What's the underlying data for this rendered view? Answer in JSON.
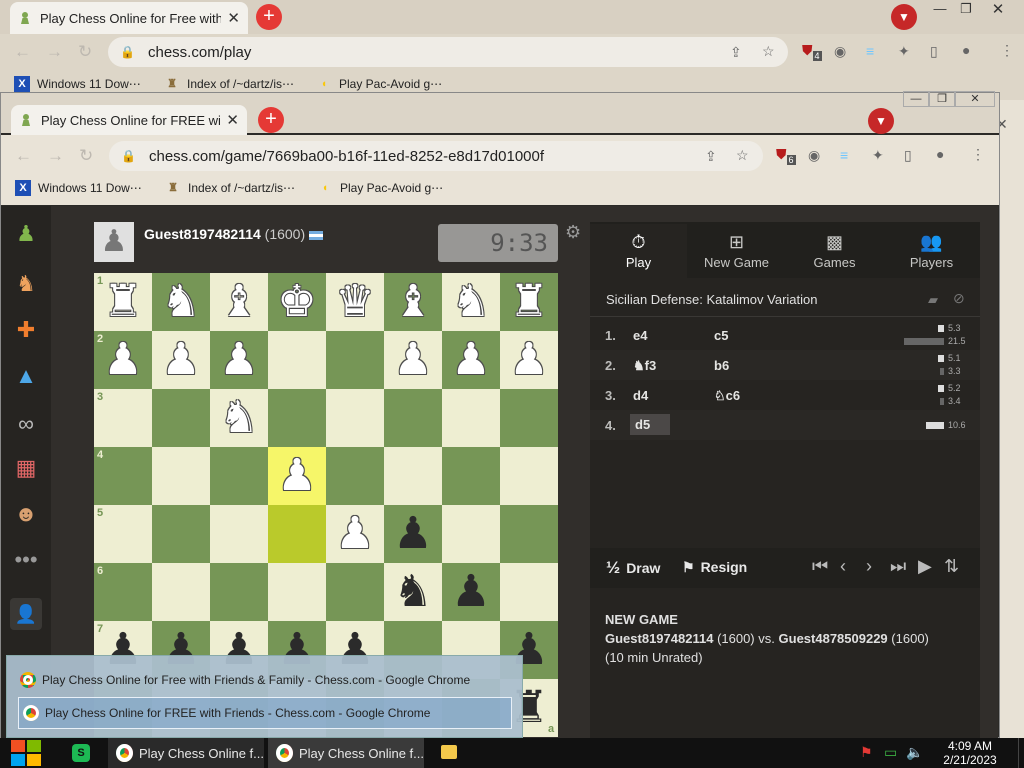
{
  "outer_window": {
    "tab_title": "Play Chess Online for Free with Friends & Family - Chess.com",
    "url": "chess.com/play",
    "ext_badge": "4",
    "bookmarks": [
      "Windows 11 Dow⋯",
      "Index of /~dartz/is⋯",
      "Play Pac-Avoid g⋯"
    ]
  },
  "inner_window": {
    "tab_title": "Play Chess Online for FREE with Friends - Chess.com",
    "url": "chess.com/game/7669ba00-b16f-11ed-8252-e8d17d01000f",
    "ext_badge": "6",
    "bookmarks": [
      "Windows 11 Dow⋯",
      "Index of /~dartz/is⋯",
      "Play Pac-Avoid g⋯"
    ]
  },
  "game": {
    "opponent": "Guest8197482114",
    "opponent_rating": "(1600)",
    "clock": "9:33",
    "board": {
      "rows": [
        [
          "R",
          "N",
          "B",
          "K",
          "Q",
          "B",
          "N",
          "R"
        ],
        [
          "P",
          "P",
          "P",
          "",
          "",
          "P",
          "P",
          "P"
        ],
        [
          "",
          "",
          "N",
          "",
          "",
          "",
          "",
          ""
        ],
        [
          "",
          "",
          "",
          "P",
          "",
          "",
          "",
          ""
        ],
        [
          "",
          "",
          "",
          "",
          "P",
          "p",
          "",
          ""
        ],
        [
          "",
          "",
          "",
          "",
          "",
          "n",
          "p",
          ""
        ],
        [
          "p",
          "p",
          "p",
          "p",
          "p",
          "",
          "",
          "p"
        ],
        [
          "",
          "",
          "",
          "",
          "",
          "",
          "",
          "r"
        ]
      ],
      "rank_labels": [
        "1",
        "2",
        "3",
        "4",
        "5",
        "6",
        "7"
      ],
      "file_label_h": "a",
      "highlighted_squares": [
        "e4",
        "e5"
      ],
      "colors": {
        "light": "#eeeed2",
        "dark": "#769656",
        "highlight_light": "#f6f669",
        "highlight_dark": "#baca2b"
      }
    }
  },
  "panel": {
    "tabs": [
      "Play",
      "New Game",
      "Games",
      "Players"
    ],
    "opening": "Sicilian Defense: Katalimov Variation",
    "moves": [
      {
        "no": "1.",
        "white": "e4",
        "black": "c5",
        "wt": "5.3",
        "bt": "21.5",
        "wt_frac": 0.15,
        "bt_frac": 1.0
      },
      {
        "no": "2.",
        "white": "f3",
        "white_piece": "♞",
        "black": "b6",
        "wt": "5.1",
        "bt": "3.3",
        "wt_frac": 0.14,
        "bt_frac": 0.1
      },
      {
        "no": "3.",
        "white": "d4",
        "black": "c6",
        "black_piece": "♘",
        "wt": "5.2",
        "bt": "3.4",
        "wt_frac": 0.14,
        "bt_frac": 0.1
      },
      {
        "no": "4.",
        "white": "d5",
        "black": "",
        "wt": "10.6",
        "bt": "",
        "wt_frac": 0.45,
        "bt_frac": 0
      }
    ],
    "draw_symbol": "½",
    "draw_label": "Draw",
    "resign_label": "Resign",
    "new_game_heading": "NEW GAME",
    "white_player": "Guest8197482114",
    "white_rating": "(1600)",
    "vs": "vs.",
    "black_player": "Guest4878509229",
    "black_rating": "(1600)",
    "mode": "(10 min Unrated)"
  },
  "taskbar_popup": {
    "items": [
      "Play Chess Online for Free with Friends & Family - Chess.com - Google Chrome",
      "Play Chess Online for FREE with Friends - Chess.com - Google Chrome"
    ]
  },
  "taskbar": {
    "buttons": [
      "Play Chess Online f...",
      "Play Chess Online f..."
    ],
    "time": "4:09 AM",
    "date": "2/21/2023"
  }
}
